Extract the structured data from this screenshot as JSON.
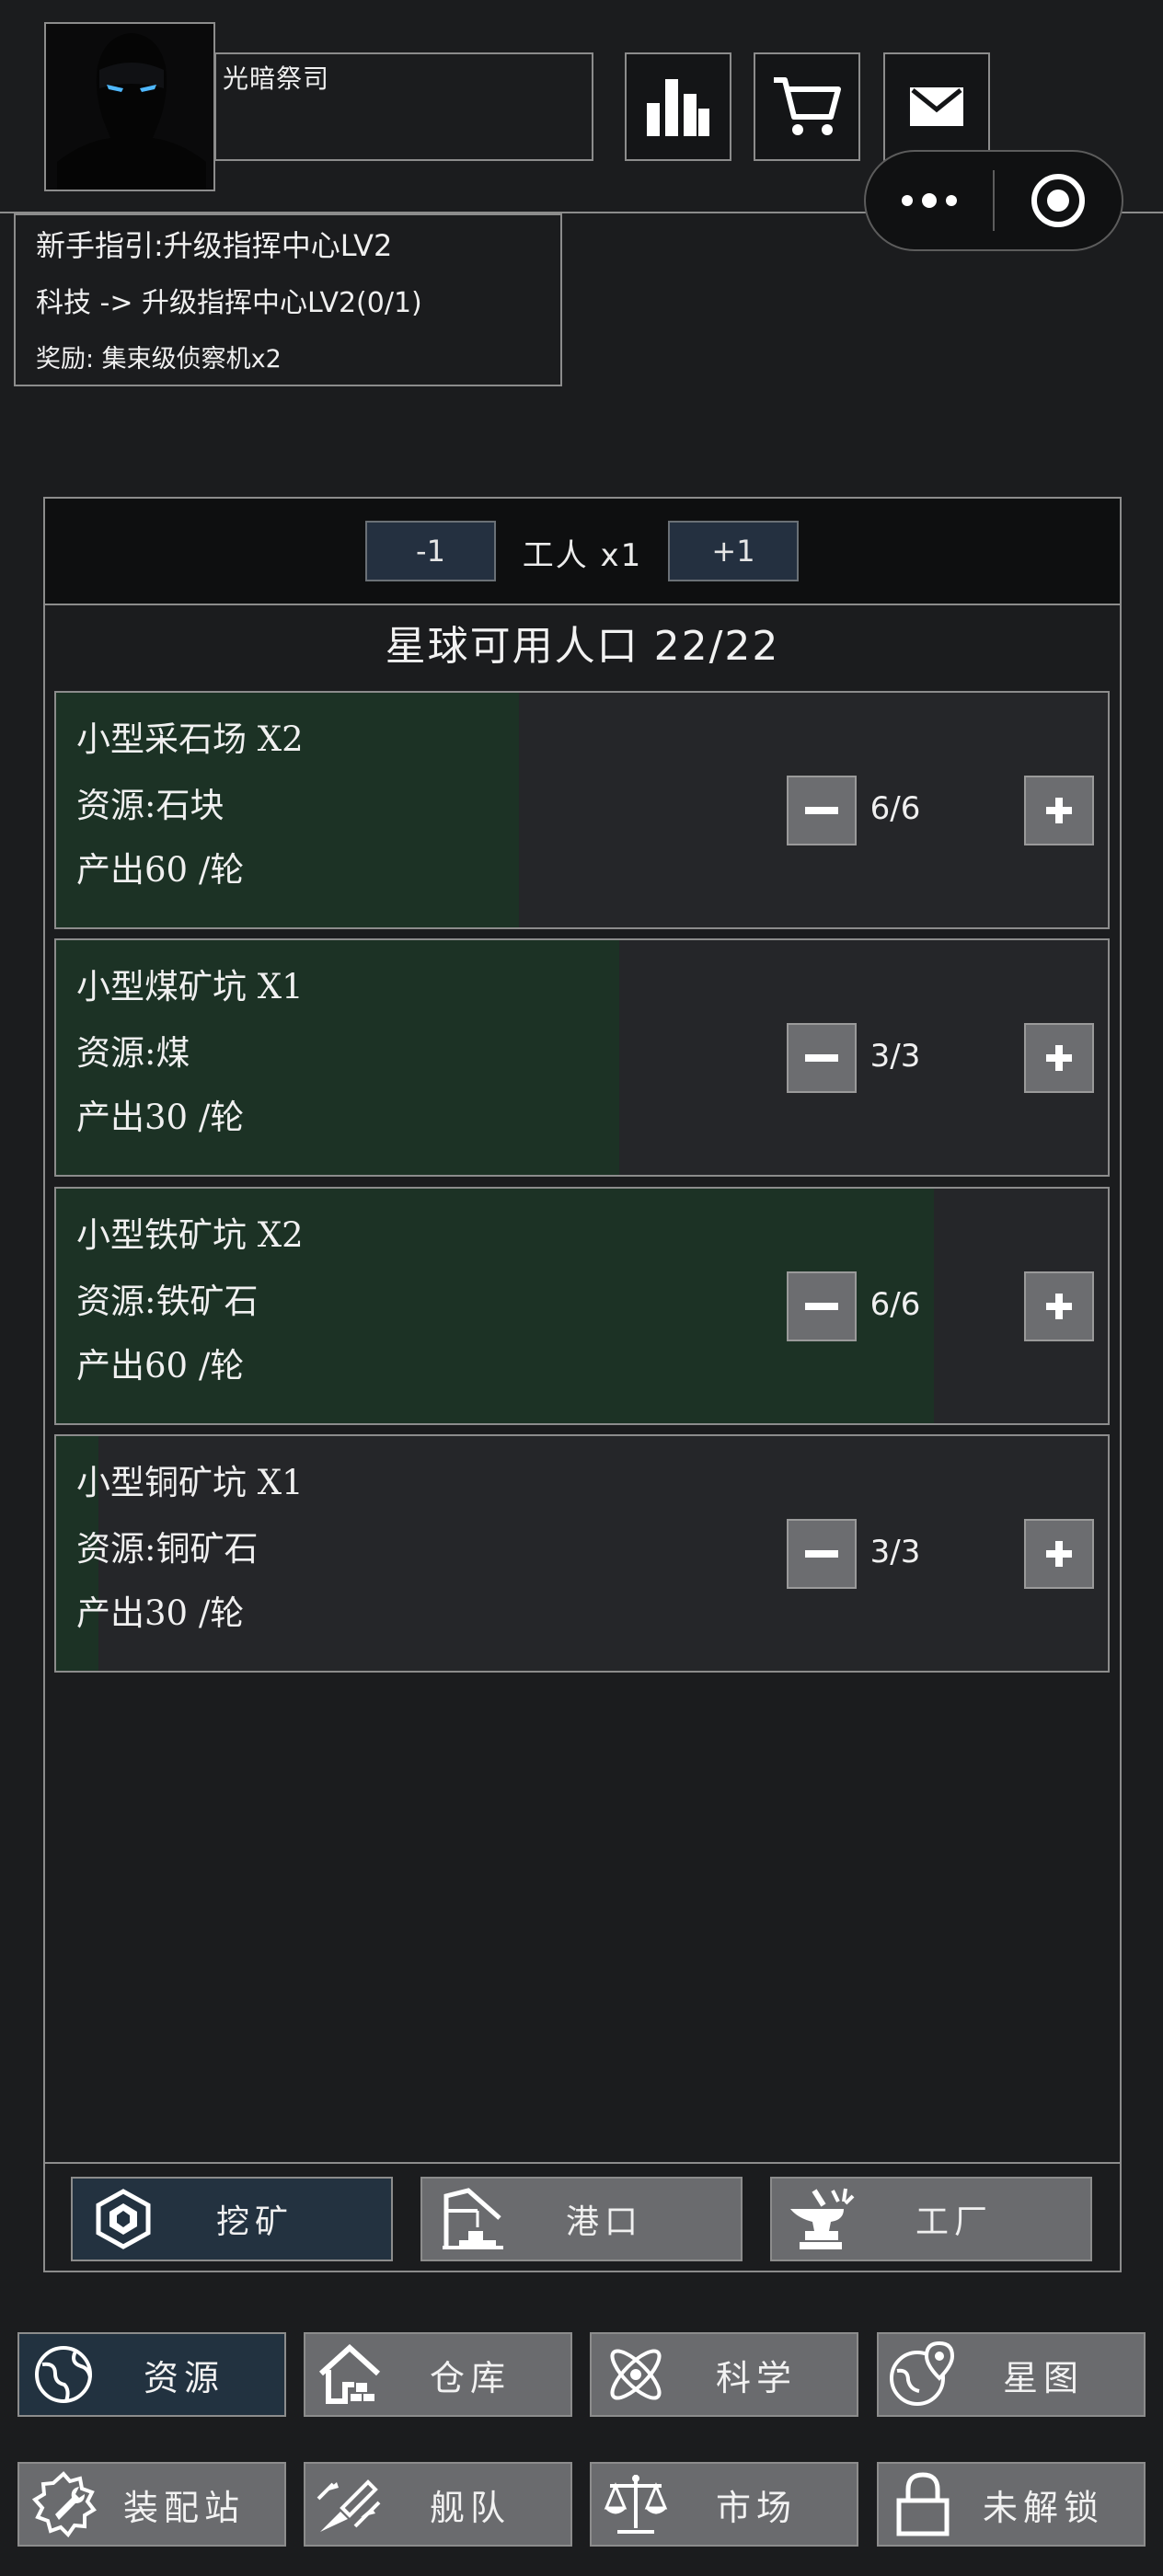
{
  "header": {
    "player_name": "光暗祭司",
    "icons": [
      "stats-icon",
      "cart-icon",
      "mail-icon"
    ]
  },
  "capsule": {
    "more": "more-icon",
    "close": "target-icon"
  },
  "guide": {
    "line1": "新手指引:升级指挥中心LV2",
    "line2": "科技 -> 升级指挥中心LV2(0/1)",
    "line3": "奖励: 集束级侦察机x2"
  },
  "workers": {
    "minus": "-1",
    "label": "工人 x1",
    "plus": "+1"
  },
  "population": "星球可用人口 22/22",
  "sites": [
    {
      "title": "小型采石场 X2",
      "resource": "资源:石块",
      "output": "产出60 /轮",
      "count": "6/6",
      "progress": 0.44
    },
    {
      "title": "小型煤矿坑 X1",
      "resource": "资源:煤",
      "output": "产出30 /轮",
      "count": "3/3",
      "progress": 0.535
    },
    {
      "title": "小型铁矿坑 X2",
      "resource": "资源:铁矿石",
      "output": "产出60 /轮",
      "count": "6/6",
      "progress": 0.835
    },
    {
      "title": "小型铜矿坑 X1",
      "resource": "资源:铜矿石",
      "output": "产出30 /轮",
      "count": "3/3",
      "progress": 0.04
    }
  ],
  "subtabs": [
    {
      "label": "挖矿",
      "icon": "mining-icon",
      "active": true
    },
    {
      "label": "港口",
      "icon": "crane-icon",
      "active": false
    },
    {
      "label": "工厂",
      "icon": "anvil-icon",
      "active": false
    }
  ],
  "nav": [
    {
      "label": "资源",
      "icon": "planet-icon",
      "active": true
    },
    {
      "label": "仓库",
      "icon": "warehouse-icon",
      "active": false
    },
    {
      "label": "科学",
      "icon": "atom-icon",
      "active": false
    },
    {
      "label": "星图",
      "icon": "map-pin-icon",
      "active": false
    },
    {
      "label": "装配站",
      "icon": "gear-wrench-icon",
      "active": false
    },
    {
      "label": "舰队",
      "icon": "fleet-icon",
      "active": false
    },
    {
      "label": "市场",
      "icon": "scales-icon",
      "active": false
    },
    {
      "label": "未解锁",
      "icon": "lock-icon",
      "active": false
    }
  ]
}
